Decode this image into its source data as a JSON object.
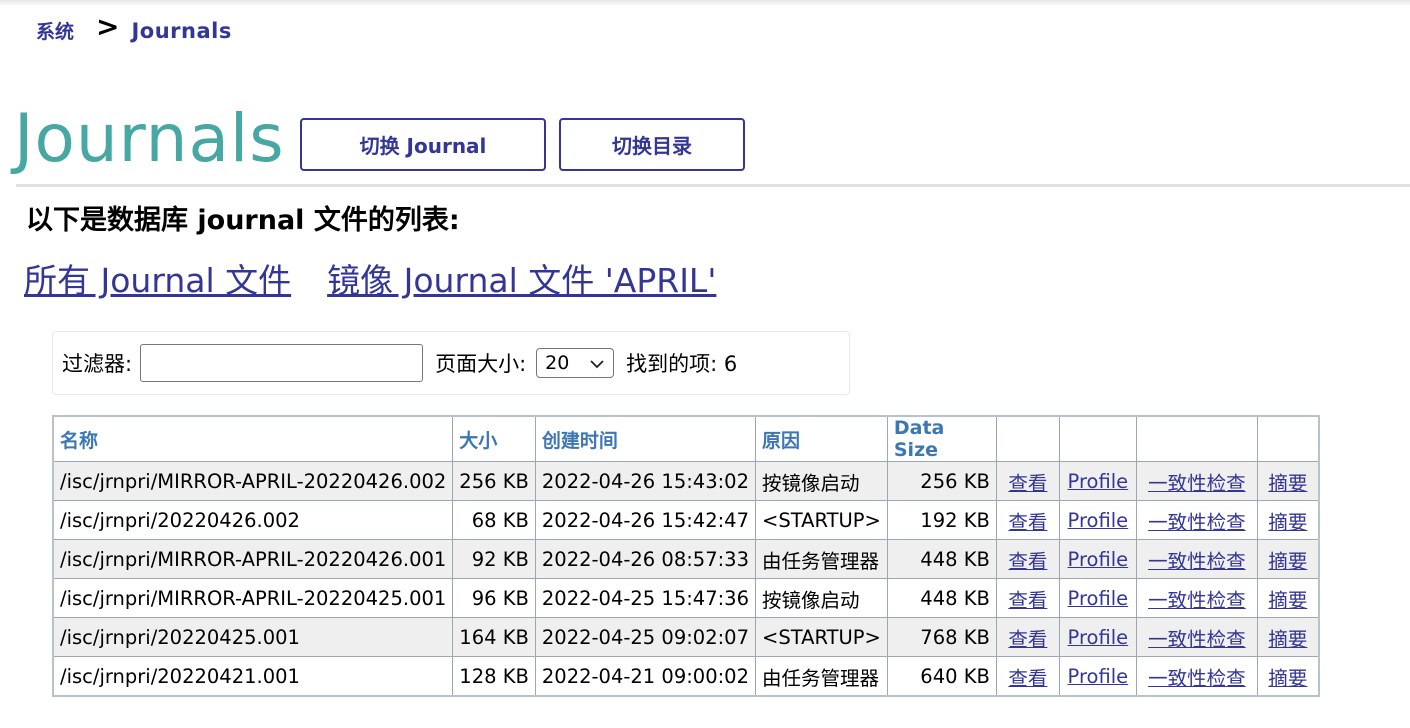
{
  "breadcrumb": {
    "home": "系统",
    "separator": ">",
    "current": "Journals"
  },
  "page_title": "Journals",
  "buttons": {
    "switch_journal": "切换 Journal",
    "switch_directory": "切换目录"
  },
  "subtitle": "以下是数据库 journal 文件的列表:",
  "links": {
    "all_journals": "所有 Journal 文件",
    "mirror_journals": "镜像 Journal 文件 'APRIL'"
  },
  "filter": {
    "label": "过滤器:",
    "value": "",
    "page_size_label": "页面大小:",
    "page_size_value": "20",
    "found_label": "找到的项:",
    "found_count": "6"
  },
  "table": {
    "headers": [
      "名称",
      "大小",
      "创建时间",
      "原因",
      "Data Size",
      "",
      "",
      "",
      ""
    ],
    "rows": [
      {
        "name": "/isc/jrnpri/MIRROR-APRIL-20220426.002",
        "size": "256 KB",
        "created": "2022-04-26 15:43:02",
        "reason": "按镜像启动",
        "data_size": "256 KB",
        "view": "查看",
        "profile": "Profile",
        "integrity": "一致性检查",
        "summary": "摘要"
      },
      {
        "name": "/isc/jrnpri/20220426.002",
        "size": "68 KB",
        "created": "2022-04-26 15:42:47",
        "reason": "<STARTUP>",
        "data_size": "192 KB",
        "view": "查看",
        "profile": "Profile",
        "integrity": "一致性检查",
        "summary": "摘要"
      },
      {
        "name": "/isc/jrnpri/MIRROR-APRIL-20220426.001",
        "size": "92 KB",
        "created": "2022-04-26 08:57:33",
        "reason": "由任务管理器",
        "data_size": "448 KB",
        "view": "查看",
        "profile": "Profile",
        "integrity": "一致性检查",
        "summary": "摘要"
      },
      {
        "name": "/isc/jrnpri/MIRROR-APRIL-20220425.001",
        "size": "96 KB",
        "created": "2022-04-25 15:47:36",
        "reason": "按镜像启动",
        "data_size": "448 KB",
        "view": "查看",
        "profile": "Profile",
        "integrity": "一致性检查",
        "summary": "摘要"
      },
      {
        "name": "/isc/jrnpri/20220425.001",
        "size": "164 KB",
        "created": "2022-04-25 09:02:07",
        "reason": "<STARTUP>",
        "data_size": "768 KB",
        "view": "查看",
        "profile": "Profile",
        "integrity": "一致性检查",
        "summary": "摘要"
      },
      {
        "name": "/isc/jrnpri/20220421.001",
        "size": "128 KB",
        "created": "2022-04-21 09:00:02",
        "reason": "由任务管理器",
        "data_size": "640 KB",
        "view": "查看",
        "profile": "Profile",
        "integrity": "一致性检查",
        "summary": "摘要"
      }
    ]
  },
  "colors": {
    "title_teal": "#47a7a2",
    "brand_navy": "#333695",
    "header_blue": "#3c77b3",
    "row_alt": "#efefef"
  },
  "icons": {
    "select_arrow": "chevron-down-icon"
  }
}
